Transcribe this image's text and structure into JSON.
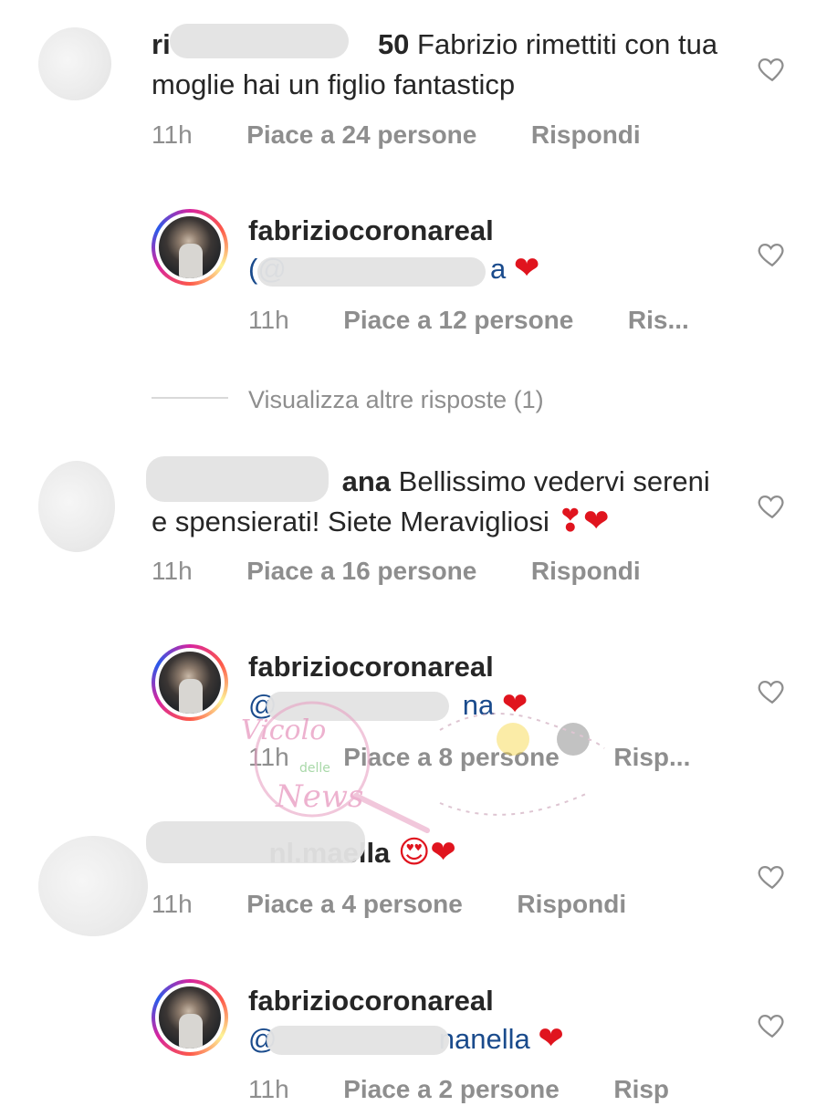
{
  "comments": [
    {
      "username_visible": "ri",
      "username_tail": "50",
      "text_line1": "Fabrizio rimettiti con tua",
      "text_line2": "moglie hai un figlio fantasticp",
      "time": "11h",
      "likes": "Piace a 24 persone",
      "reply": "Rispondi"
    },
    {
      "username": "fabriziocoronareal",
      "mention_visible": "(@",
      "mention_tail": "a",
      "emoji": "❤",
      "time": "11h",
      "likes": "Piace a 12 persone",
      "reply": "Ris..."
    },
    {
      "username_tail": "ana",
      "text_line1": "Bellissimo vedervi sereni",
      "text_line2": "e spensierati! Siete Meravigliosi",
      "emoji": "❣❤",
      "time": "11h",
      "likes": "Piace a 16 persone",
      "reply": "Rispondi"
    },
    {
      "username": "fabriziocoronareal",
      "mention_visible": "@",
      "mention_tail": "na",
      "emoji": "❤",
      "time": "11h",
      "likes": "Piace a 8 persone",
      "reply": "Risp..."
    },
    {
      "username_tail": "ella",
      "username_mid": "nl.ma",
      "emoji": "😍❤",
      "time": "11h",
      "likes": "Piace a 4 persone",
      "reply": "Rispondi"
    },
    {
      "username": "fabriziocoronareal",
      "mention_visible": "@",
      "mention_tail": "nanella",
      "emoji": "❤",
      "time": "11h",
      "likes": "Piace a 2 persone",
      "reply": "Risp"
    }
  ],
  "view_more_replies": "Visualizza altre risposte (1)",
  "watermark": {
    "line1": "Vicolo",
    "line2": "delle",
    "line3": "News"
  },
  "colors": {
    "text": "#262626",
    "meta": "#8e8e8e",
    "mention": "#1a4b8c",
    "heart_red": "#e0141e"
  },
  "icons": {
    "like": "heart-outline-icon",
    "love_emoji": "red-heart-emoji",
    "heart_eyes": "heart-eyes-emoji"
  }
}
